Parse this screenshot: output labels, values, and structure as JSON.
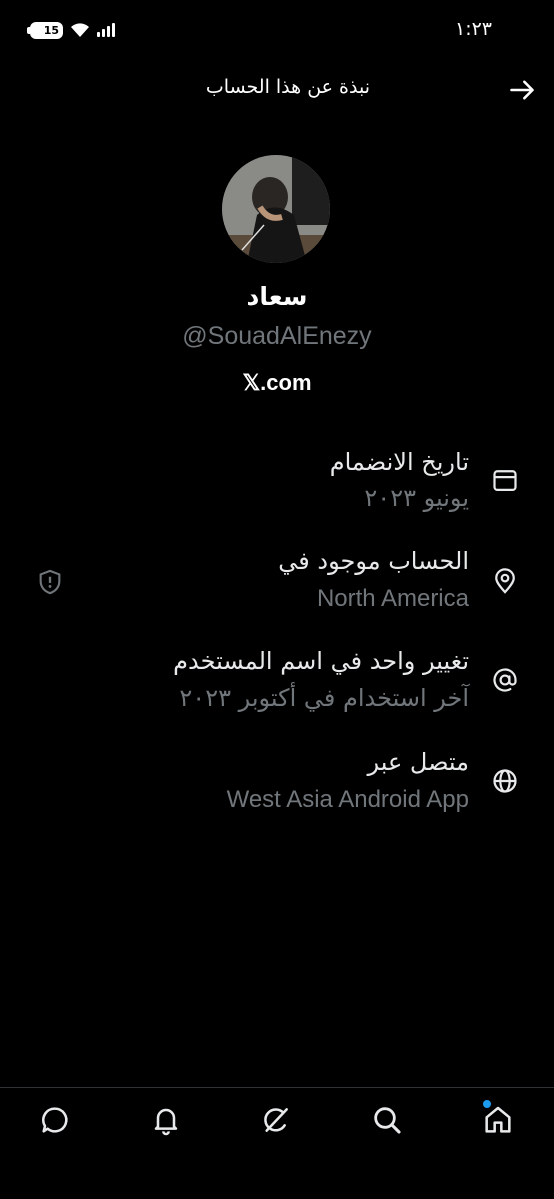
{
  "status_bar": {
    "time": "١:٢٣",
    "battery": "15"
  },
  "header": {
    "title": "نبذة عن هذا الحساب"
  },
  "profile": {
    "name": "سعاد",
    "handle": "@SouadAlEnezy",
    "site": "𝕏.com"
  },
  "details": [
    {
      "icon": "calendar-icon",
      "title": "تاريخ الانضمام",
      "value": "يونيو ٢٠٢٣"
    },
    {
      "icon": "location-pin-icon",
      "title": "الحساب موجود في",
      "value": "North America"
    },
    {
      "icon": "at-sign-icon",
      "title": "تغيير واحد في اسم المستخدم",
      "value": "آخر استخدام في أكتوبر ٢٠٢٣"
    },
    {
      "icon": "globe-icon",
      "title": "متصل عبر",
      "value": "West Asia Android App"
    }
  ],
  "colors": {
    "background": "#000000",
    "primary_text": "#e7e9ea",
    "secondary_text": "#71767b",
    "accent": "#1d9bf0"
  }
}
